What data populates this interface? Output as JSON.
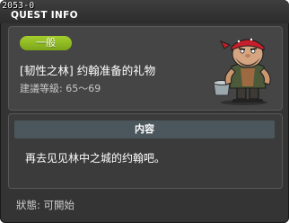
{
  "window": {
    "id": "2053-0",
    "title": "QUEST INFO"
  },
  "quest": {
    "badge": "一般",
    "name": "[韧性之林] 约翰准备的礼物",
    "level_requirement": "建議等級: 65〜69",
    "npc_icon": "npc-portrait-bandana-man"
  },
  "content": {
    "header": "内容",
    "text": "再去见见林中之城的约翰吧。"
  },
  "status": "狀態: 可開始",
  "colors": {
    "badge": "#8bb81f",
    "panel": "#454545",
    "content_header": "#4c575d"
  }
}
